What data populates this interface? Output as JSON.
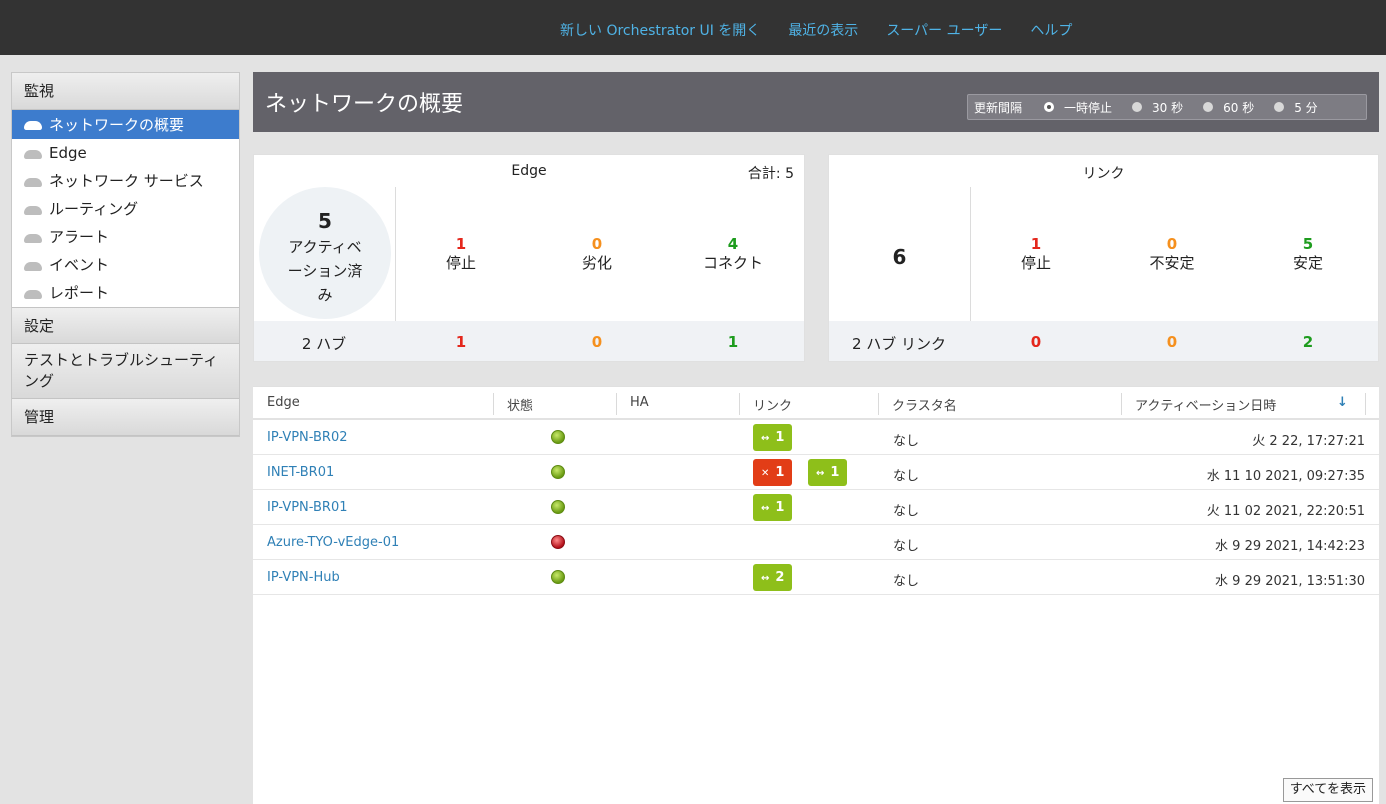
{
  "topnav": {
    "items": [
      "新しい Orchestrator UI を開く",
      "最近の表示",
      "スーパー ユーザー",
      "ヘルプ"
    ]
  },
  "sidebar": {
    "monitor": "監視",
    "items": [
      {
        "label": "ネットワークの概要",
        "active": true
      },
      {
        "label": "Edge"
      },
      {
        "label": "ネットワーク サービス"
      },
      {
        "label": "ルーティング"
      },
      {
        "label": "アラート"
      },
      {
        "label": "イベント"
      },
      {
        "label": "レポート"
      }
    ],
    "settings": "設定",
    "test": "テストとトラブルシューティング",
    "admin": "管理"
  },
  "header": {
    "title": "ネットワークの概要",
    "refresh_label": "更新間隔",
    "refresh_options": [
      "一時停止",
      "30 秒",
      "60 秒",
      "5 分"
    ],
    "refresh_selected": "一時停止"
  },
  "edge_card": {
    "title": "Edge",
    "total": "合計: 5",
    "active_count": "5",
    "active_label": "アクティベーション済み",
    "stats": [
      {
        "n": "1",
        "label": "停止"
      },
      {
        "n": "0",
        "label": "劣化"
      },
      {
        "n": "4",
        "label": "コネクト"
      }
    ],
    "footer_label": "2 ハブ",
    "footer_values": [
      "1",
      "0",
      "1"
    ]
  },
  "link_card": {
    "title": "リンク",
    "count": "6",
    "stats": [
      {
        "n": "1",
        "label": "停止"
      },
      {
        "n": "0",
        "label": "不安定"
      },
      {
        "n": "5",
        "label": "安定"
      }
    ],
    "footer_label": "2 ハブ リンク",
    "footer_values": [
      "0",
      "0",
      "2"
    ]
  },
  "table": {
    "columns": [
      "Edge",
      "状態",
      "HA",
      "リンク",
      "クラスタ名",
      "アクティベーション日時"
    ],
    "sort_icon": "arrow-down-icon",
    "rows": [
      {
        "name": "IP-VPN-BR02",
        "status": "ok",
        "links": [
          {
            "type": "up",
            "count": "1"
          }
        ],
        "cluster": "なし",
        "date": "火 2 22, 17:27:21"
      },
      {
        "name": "INET-BR01",
        "status": "ok",
        "links": [
          {
            "type": "down",
            "count": "1"
          },
          {
            "type": "up",
            "count": "1"
          }
        ],
        "cluster": "なし",
        "date": "水 11 10 2021, 09:27:35"
      },
      {
        "name": "IP-VPN-BR01",
        "status": "ok",
        "links": [
          {
            "type": "up",
            "count": "1"
          }
        ],
        "cluster": "なし",
        "date": "火 11 02 2021, 22:20:51"
      },
      {
        "name": "Azure-TYO-vEdge-01",
        "status": "bad",
        "links": [],
        "cluster": "なし",
        "date": "水 9 29 2021, 14:42:23"
      },
      {
        "name": "IP-VPN-Hub",
        "status": "ok",
        "links": [
          {
            "type": "up",
            "count": "2"
          }
        ],
        "cluster": "なし",
        "date": "水 9 29 2021, 13:51:30"
      }
    ],
    "show_all": "すべてを表示"
  },
  "colors": {
    "down": "#e4271c",
    "degraded": "#f5901e",
    "up": "#1e9c1e",
    "active_nav": "#3d7ccd",
    "link_text": "#2f80b6"
  }
}
